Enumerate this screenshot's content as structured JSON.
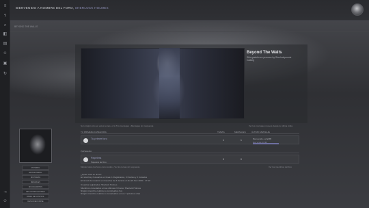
{
  "header": {
    "welcome_prefix": "Bienvenido a nombre del foro,",
    "welcome_user": "Sherlock Holmes",
    "breadcrumb": "Beyond The Walls"
  },
  "sidebar": {
    "icons": [
      "question-icon",
      "search-icon",
      "bookmark-icon",
      "list-icon",
      "users-icon",
      "lock-icon",
      "refresh-icon",
      "login-icon",
      "power-icon"
    ]
  },
  "hero": {
    "title": "Beyond The Walls",
    "subtitle": "Skin gratuito en proceso by Sherlockpunnie Cadaig"
  },
  "info": {
    "line": "Son ningún otro en estos temas, o Gi Tus mensajes • Mensajes sin respuesta",
    "right": "Ver los mensajes nuevos desde tu última visita"
  },
  "table": {
    "headers": [
      "Tu primera categoría",
      "Temas",
      "Mensajes",
      "Último mensaje"
    ],
    "rows": [
      {
        "name": "Tu primer foro",
        "desc": "",
        "topics": "1",
        "posts": "1",
        "last": "Bienvenido a phpBB",
        "last_user": "Hoy a las 14:34"
      },
      {
        "name": "Papelera",
        "desc": "Papelera del foro",
        "topics": "0",
        "posts": "0",
        "last": "",
        "last_user": ""
      }
    ],
    "section2": "Papelera"
  },
  "mark": {
    "left": "Marcar todos los foros como leídos • Ver los temas sin respuesta",
    "right": "Ver los miembros del foro"
  },
  "stats": {
    "title": "¿Quién está en línea?",
    "lines": [
      "En total hay 3 usuarios en línea: 1 Registrados, 0 Ocultos y 2 Invitados",
      "El récord de usuarios en línea fue de 3 durante el día 24 Nov 2020 - 17:10",
      "Usuarios registrados: Sherlock Holmes",
      "Miembros conectados en las últimas 24 horas: Sherlock Holmes",
      "Ningún miembro celebra su cumpleaños hoy",
      "Ningún miembro celebra su cumpleaños en los 7 próximos días"
    ]
  },
  "profile": {
    "links": [
      "Mi perfil",
      "Editar perfil",
      "Mis temas",
      "Mensajes",
      "Mis favoritos",
      "Mis notificaciones",
      "Panel de control",
      "Desconectarse"
    ]
  }
}
